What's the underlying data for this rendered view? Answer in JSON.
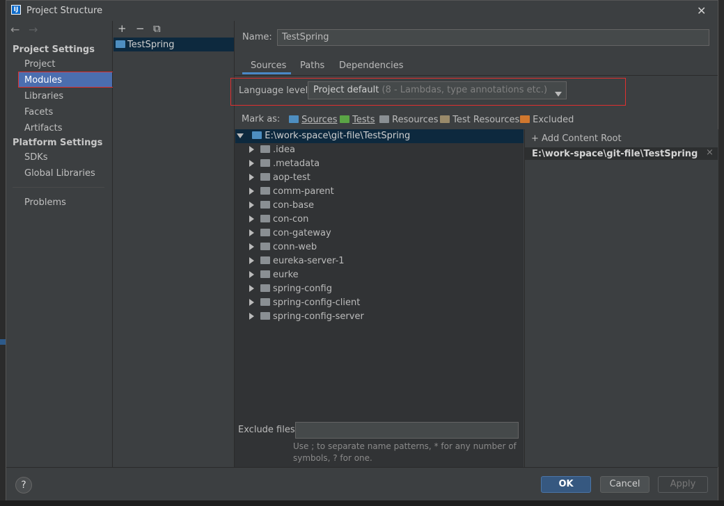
{
  "window": {
    "title": "Project Structure",
    "close_glyph": "✕",
    "app_icon_text": "IJ"
  },
  "nav": {
    "back": "←",
    "forward": "→"
  },
  "sidebar": {
    "project_settings": "Project Settings",
    "items_ps": [
      "Project",
      "Modules",
      "Libraries",
      "Facets",
      "Artifacts"
    ],
    "platform_settings": "Platform Settings",
    "items_pl": [
      "SDKs",
      "Global Libraries"
    ],
    "problems": "Problems",
    "selected": "Modules"
  },
  "modules_toolbar": {
    "add": "+",
    "remove": "−",
    "copy": "⧉"
  },
  "modules": [
    "TestSpring"
  ],
  "name_field": {
    "label": "Name:",
    "value": "TestSpring"
  },
  "tabs": [
    "Sources",
    "Paths",
    "Dependencies"
  ],
  "active_tab": "Sources",
  "language_level": {
    "label": "Language level:",
    "value": "Project default",
    "hint": "(8 - Lambdas, type annotations etc.)"
  },
  "mark_as": {
    "label": "Mark as:",
    "options": [
      "Sources",
      "Tests",
      "Resources",
      "Test Resources",
      "Excluded"
    ]
  },
  "tree": {
    "root": "E:\\work-space\\git-file\\TestSpring",
    "children": [
      ".idea",
      ".metadata",
      "aop-test",
      "comm-parent",
      "con-base",
      "con-con",
      "con-gateway",
      "conn-web",
      "eureka-server-1",
      "eurke",
      "spring-config",
      "spring-config-client",
      "spring-config-server"
    ]
  },
  "content_root": {
    "add_label": "+ Add Content Root",
    "path": "E:\\work-space\\git-file\\TestSpring",
    "remove_glyph": "×"
  },
  "exclude": {
    "label": "Exclude files:",
    "value": "",
    "help_line1": "Use ; to separate name patterns, * for any number of",
    "help_line2": "symbols, ? for one."
  },
  "buttons": {
    "help": "?",
    "ok": "OK",
    "cancel": "Cancel",
    "apply": "Apply"
  },
  "colors": {
    "accent": "#4b6eaf",
    "highlight_box": "#e03030",
    "ok_button": "#365880"
  }
}
